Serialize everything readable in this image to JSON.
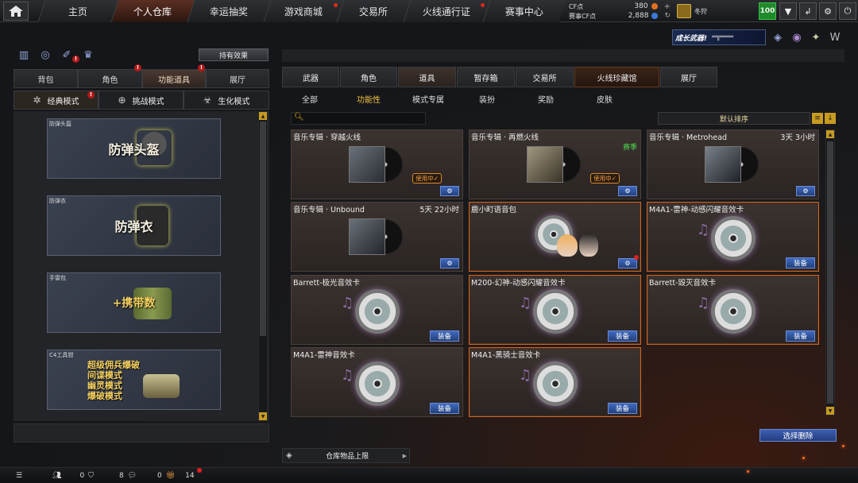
{
  "nav": {
    "tabs": [
      "主页",
      "个人仓库",
      "幸运抽奖",
      "游戏商城",
      "交易所",
      "火线通行证",
      "赛事中心"
    ],
    "active_tab": "个人仓库",
    "cf": {
      "label": "CF点",
      "value": "380"
    },
    "event_cf": {
      "label": "赛事CF点",
      "value": "2,888"
    },
    "username": "冬狩",
    "level_badge": "100"
  },
  "left": {
    "effect_button": "持有效果",
    "tabs": [
      "背包",
      "角色",
      "功能道具",
      "展厅"
    ],
    "active_tab": "功能道具",
    "modes": [
      "经典模式",
      "挑战模式",
      "生化模式"
    ],
    "active_mode": "经典模式",
    "items": [
      {
        "caption": "防弹头盔",
        "title": "防弹头盔"
      },
      {
        "caption": "防弹衣",
        "title": "防弹衣"
      },
      {
        "caption": "手雷包",
        "title": "+携带数"
      },
      {
        "caption": "C4工具钳",
        "lines": [
          "超级佣兵爆破",
          "间谍模式",
          "幽灵模式",
          "爆破模式"
        ]
      }
    ]
  },
  "right": {
    "promo": "成长武器!",
    "tabs": [
      "武器",
      "角色",
      "道具",
      "暂存箱",
      "交易所",
      "火线珍藏馆",
      "展厅"
    ],
    "active_tab": "道具",
    "subtabs": [
      "全部",
      "功能性",
      "模式专属",
      "装扮",
      "奖励",
      "皮肤"
    ],
    "active_subtab": "功能性",
    "sort_label": "默认排序",
    "items": [
      {
        "name": "音乐专辑 · 穿越火线",
        "status": "使用中✓"
      },
      {
        "name": "音乐专辑 · 再燃火线",
        "tag": "赛季",
        "status": "使用中✓"
      },
      {
        "name": "音乐专辑 · Metrohead",
        "time": "3天 3小时"
      },
      {
        "name": "音乐专辑 · Unbound",
        "time": "5天 22小时"
      },
      {
        "name": "鹿小町语音包"
      },
      {
        "name": "M4A1-雷神-动感闪耀音效卡",
        "button": "装备"
      },
      {
        "name": "Barrett-极光音效卡",
        "button": "装备"
      },
      {
        "name": "M200-幻神-动感闪耀音效卡",
        "button": "装备"
      },
      {
        "name": "Barrett-毁灭音效卡",
        "button": "装备"
      },
      {
        "name": "M4A1-雷神音效卡",
        "button": "装备"
      },
      {
        "name": "M4A1-黑骑士音效卡",
        "button": "装备"
      }
    ],
    "select_delete": "选择删除",
    "capacity": "仓库物品上限"
  },
  "bottom": {
    "count1": "0",
    "count2": "8",
    "count3": "0",
    "count4": "14"
  }
}
